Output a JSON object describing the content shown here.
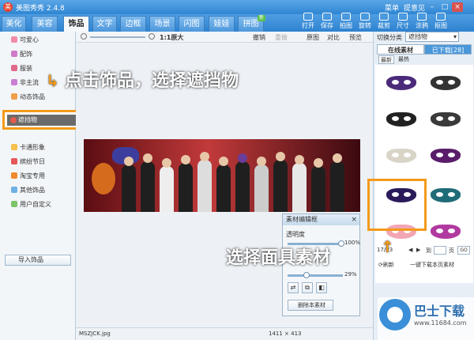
{
  "app": {
    "title": "美图秀秀 2.4.8",
    "menu": "菜单",
    "feedback": "提意见"
  },
  "tabs": [
    {
      "label": "美化"
    },
    {
      "label": "美容"
    },
    {
      "label": "饰品",
      "active": true
    },
    {
      "label": "文字"
    },
    {
      "label": "边框"
    },
    {
      "label": "场景"
    },
    {
      "label": "闪图"
    },
    {
      "label": "娃娃"
    },
    {
      "label": "拼图",
      "badge": "新"
    }
  ],
  "tools": [
    "打开",
    "保存",
    "拍图",
    "旋转",
    "裁剪",
    "尺寸",
    "涂鸦",
    "抠图"
  ],
  "toolbar2": {
    "zoom": "1:1原大",
    "undo": "撤销",
    "redo": "重做",
    "original": "原图",
    "compare": "对比",
    "preview": "预览"
  },
  "sidebar": {
    "items": [
      "可爱心",
      "配饰",
      "服装",
      "非主流",
      "动态饰品"
    ],
    "selected": "遮挡物",
    "items2": [
      "卡通形象",
      "缤纷节日",
      "淘宝专用",
      "其他饰品",
      "用户自定义"
    ],
    "import": "导入饰品"
  },
  "callouts": {
    "left": "点击饰品，选择遮挡物",
    "right": "选择面具素材"
  },
  "dialog": {
    "title": "素材编辑框",
    "opacity_label": "透明度",
    "opacity_value": "100%",
    "rotate_value": "29%",
    "delete": "删除本素材"
  },
  "status": {
    "filename": "MSZJCK.jpg",
    "dimensions": "1411 × 413"
  },
  "rpanel": {
    "switch_label": "切换分类",
    "category": "遮挡物",
    "tab_online": "在线素材",
    "tab_downloaded": "已下载[28]",
    "sub_new": "最新",
    "sub_hot": "最热",
    "page": "17/23",
    "page_to": "到",
    "page_unit": "页",
    "go": "GO",
    "refresh": "刷新",
    "download_all": "一键下载本页素材"
  },
  "watermark": {
    "name": "巴士下载",
    "url": "www.11684.com"
  },
  "colors": {
    "accent": "#f39a1a",
    "brand": "#2f86d3"
  }
}
